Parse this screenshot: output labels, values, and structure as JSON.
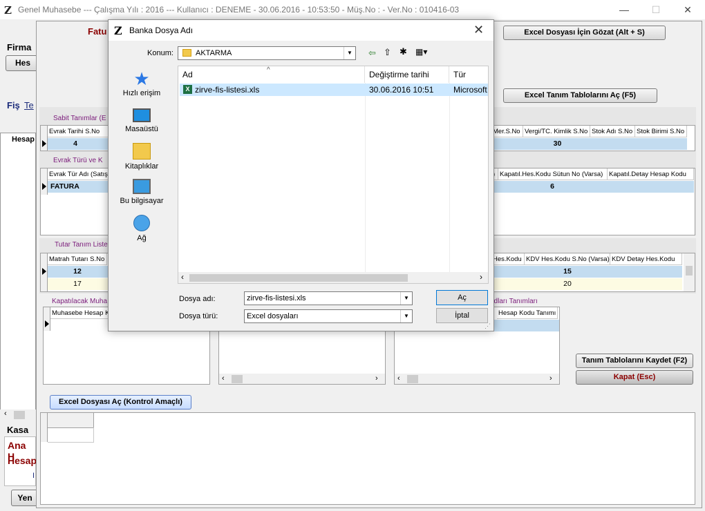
{
  "app": {
    "logo": "Z",
    "title": "Genel Muhasebe  ---  Çalışma Yılı : 2016  ---  Kullanıcı : DENEME - 30.06.2016 - 10:53:50 - Müş.No :  - Ver.No : 010416-03"
  },
  "window_controls": {
    "minimize": "—",
    "maximize": "☐",
    "close": "✕"
  },
  "left": {
    "firma": "Firma",
    "hes_btn": "Hes",
    "fis": "Fiş",
    "te": "Te",
    "hesap_col": "Hesap",
    "kasa": "Kasa",
    "ana_h": "Ana H",
    "hesap": "Hesap",
    "i": "I",
    "yen_btn": "Yen"
  },
  "main": {
    "fatu_label": "Fatu",
    "excel_gozat_btn": "Excel Dosyası İçin Gözat (Alt + S)",
    "excel_tanim_btn": "Excel Tanım Tablolarını Aç (F5)",
    "sabit_label": "Sabit Tanımlar (E",
    "sabit_headers": [
      "Evrak Tarihi S.No",
      "S",
      "Mer.S.No",
      "Vergi/TC. Kimlik S.No",
      "Stok Adı S.No",
      "Stok Birimi S.No"
    ],
    "sabit_values": [
      "4",
      "30"
    ],
    "evrak_label": "Evrak Türü ve K",
    "evrak_headers": [
      "Evrak Tür Adı (Satış",
      ")",
      "Kapatıl.Hes.Kodu Sütun No (Varsa)",
      "Kapatıl.Detay Hesap Kodu"
    ],
    "evrak_values": [
      "FATURA",
      "6"
    ],
    "tutar_label": "Tutar Tanım Liste",
    "tutar_headers": [
      "Matrah Tutarı S.No",
      "Hes.Kodu",
      "KDV Hes.Kodu S.No (Varsa)",
      "KDV Detay Hes.Kodu"
    ],
    "tutar_row1": [
      "12",
      "15"
    ],
    "tutar_row2": [
      "17",
      "20"
    ],
    "kapatilacak_label": "Kapatılacak Muha",
    "kapatilacak_header": "Muhasebe Hesap K",
    "kodlari_label": "odları Tanımları",
    "kodlari_header": "Hesap Kodu Tanımı",
    "kaydet_btn": "Tanım Tablolarını Kaydet (F2)",
    "kapat_btn": "Kapat (Esc)",
    "excel_ac_btn": "Excel Dosyası Aç (Kontrol Amaçlı)"
  },
  "dialog": {
    "logo": "Z",
    "title": "Banka Dosya Adı",
    "konum_label": "Konum:",
    "konum_value": "AKTARMA",
    "places": [
      "Hızlı erişim",
      "Masaüstü",
      "Kitaplıklar",
      "Bu bilgisayar",
      "Ağ"
    ],
    "columns": [
      "Ad",
      "Değiştirme tarihi",
      "Tür"
    ],
    "files": [
      {
        "name": "zirve-fis-listesi.xls",
        "date": "30.06.2016 10:51",
        "type": "Microsoft"
      }
    ],
    "filename_label": "Dosya adı:",
    "filename_value": "zirve-fis-listesi.xls",
    "filetype_label": "Dosya türü:",
    "filetype_value": "Excel dosyaları",
    "open_btn": "Aç",
    "cancel_btn": "İptal"
  }
}
